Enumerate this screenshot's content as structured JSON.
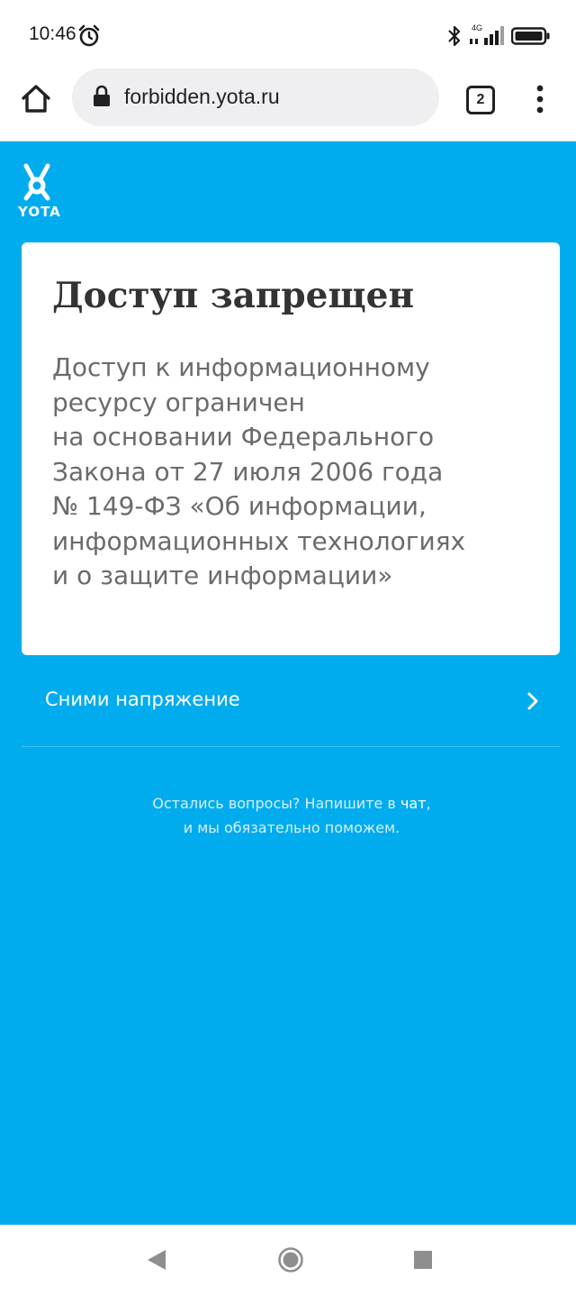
{
  "status_bar": {
    "time": "10:46",
    "network": "4G",
    "icons": [
      "alarm-icon",
      "bluetooth-icon",
      "signal-icon",
      "battery-icon"
    ]
  },
  "browser": {
    "url": "forbidden.yota.ru",
    "tab_count": "2",
    "icons": [
      "home-icon",
      "lock-icon",
      "tabs-icon",
      "more-vert-icon"
    ]
  },
  "page": {
    "logo_text": "YOTA",
    "card": {
      "title": "Доступ запрещен",
      "body_lines": [
        "Доступ к информационному",
        "ресурсу ограничен",
        "на основании Федерального",
        "Закона от 27 июля 2006 года",
        "№ 149-ФЗ «Об информации,",
        "информационных технологиях",
        "и о защите информации»"
      ]
    },
    "promo_link": {
      "label": "Сними напряжение"
    },
    "help": {
      "line1_prefix": "Остались вопросы? Напишите в ",
      "chat_link": "чат",
      "line1_suffix": ",",
      "line2": "и мы обязательно поможем."
    }
  },
  "colors": {
    "background": "#00acee",
    "card": "#ffffff",
    "title": "#333333",
    "body": "#6b6b6b"
  }
}
